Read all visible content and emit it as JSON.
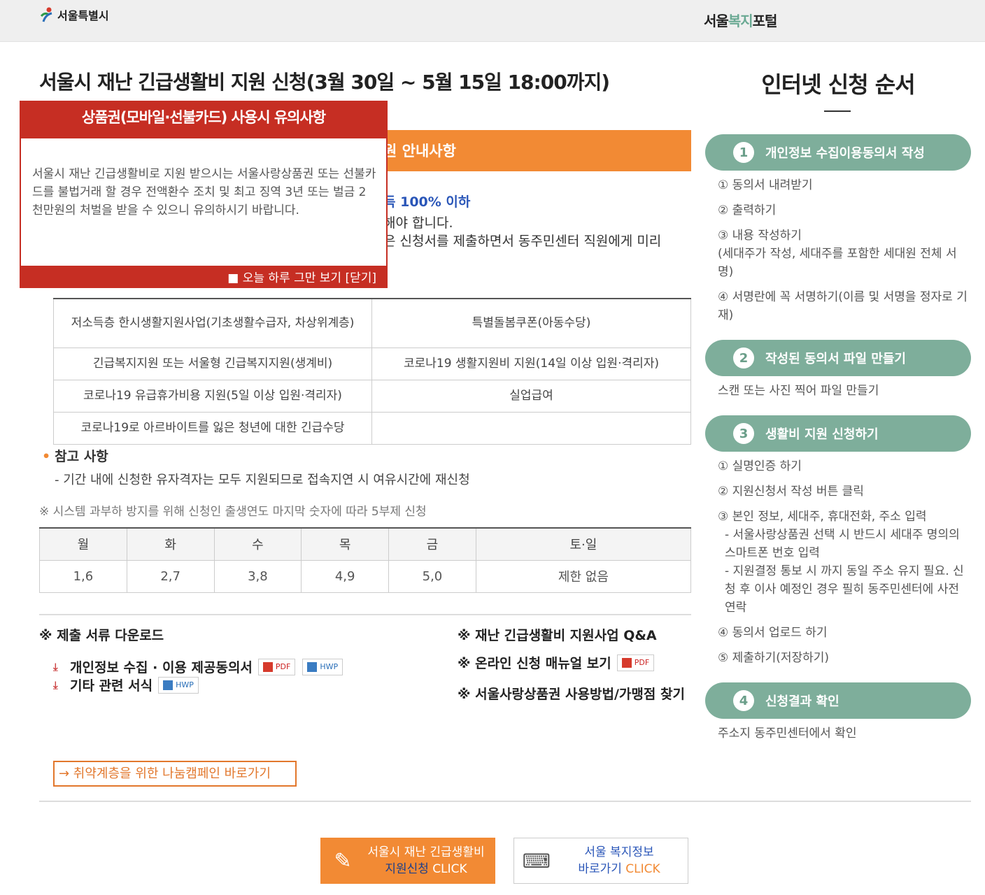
{
  "header": {
    "seoul_logo": "서울특별시",
    "portal_prefix": "서울",
    "portal_green": "복지",
    "portal_suffix": "포털"
  },
  "main": {
    "title": "서울시 재난 긴급생활비 지원 신청(3월 30일 ~ 5월 15일 18:00까지)",
    "banner": "원 안내사항",
    "criteria": "득 100% 이하",
    "line1": "해야 합니다.",
    "line2": "은 신청서를 제출하면서 동주민센터 직원에게 미리"
  },
  "popup": {
    "title": "상품권(모바일·선불카드) 사용시 유의사항",
    "body": "서울시 재난 긴급생활비로 지원 받으시는 서울사랑상품권 또는 선불카드를 불법거래 할 경우 전액환수 조치 및 최고 징역 3년 또는 벌금 2천만원의 처벌을 받을 수 있으니 유의하시기 바랍니다.",
    "footer": "■ 오늘 하루 그만 보기  [닫기]"
  },
  "program_table": {
    "rows": [
      [
        "저소득층 한시생활지원사업(기초생활수급자, 차상위계층)",
        "특별돌봄쿠폰(아동수당)"
      ],
      [
        "긴급복지지원 또는 서울형 긴급복지지원(생계비)",
        "코로나19 생활지원비 지원(14일 이상 입원·격리자)"
      ],
      [
        "코로나19 유급휴가비용 지원(5일 이상 입원·격리자)",
        "실업급여"
      ],
      [
        "코로나19로 아르바이트를 잃은 청년에 대한 긴급수당",
        ""
      ]
    ]
  },
  "reference": {
    "title": "참고 사항",
    "line": "- 기간 내에 신청한 유자격자는 모두 지원되므로 접속지연 시 여유시간에 재신청",
    "notice": "※ 시스템 과부하 방지를 위해 신청인 출생연도 마지막 숫자에 따라 5부제 신청"
  },
  "day_table": {
    "headers": [
      "월",
      "화",
      "수",
      "목",
      "금",
      "토·일"
    ],
    "values": [
      "1,6",
      "2,7",
      "3,8",
      "4,9",
      "5,0",
      "제한 없음"
    ]
  },
  "downloads": {
    "title": "※ 제출 서류 다운로드",
    "item1": "개인정보 수집 · 이용 제공동의서",
    "item2": "기타 관련 서식",
    "pdf": "PDF",
    "hwp": "HWP"
  },
  "links": {
    "qa": "※ 재난 긴급생활비 지원사업 Q&A",
    "manual": "※ 온라인 신청 매뉴얼 보기",
    "voucher": "※ 서울사랑상품권 사용방법/가맹점 찾기"
  },
  "campaign": "→ 취약계층을 위한 나눔캠페인 바로가기",
  "buttons": {
    "apply_line1": "서울시 재난 긴급생활비",
    "apply_line2a": "지원신청",
    "apply_line2b": " CLICK",
    "info_line1": "서울 복지정보",
    "info_line2a": "바로가기",
    "info_line2b": " CLICK"
  },
  "sidebar": {
    "title": "인터넷 신청 순서",
    "step1": {
      "num": "1",
      "label": "개인정보 수집이용동의서 작성"
    },
    "step1_items": [
      "① 동의서 내려받기",
      "② 출력하기",
      "③ 내용 작성하기\n(세대주가 작성, 세대주를 포함한 세대원 전체 서명)",
      "④ 서명란에 꼭 서명하기(이름 및 서명을 정자로 기재)"
    ],
    "step2": {
      "num": "2",
      "label": "작성된 동의서 파일 만들기"
    },
    "step2_items": [
      "스캔 또는 사진 찍어 파일 만들기"
    ],
    "step3": {
      "num": "3",
      "label": "생활비 지원 신청하기"
    },
    "step3_items": [
      "① 실명인증 하기",
      "② 지원신청서 작성 버튼 클릭",
      "③ 본인 정보, 세대주, 휴대전화, 주소 입력",
      "- 서울사랑상품권 선택 시 반드시 세대주 명의의 스마트폰 번호 입력",
      "- 지원결정 통보 시 까지 동일 주소 유지 필요. 신청 후 이사 예정인 경우 필히 동주민센터에 사전 연락",
      "④ 동의서 업로드 하기",
      "⑤ 제출하기(저장하기)"
    ],
    "step4": {
      "num": "4",
      "label": "신청결과 확인"
    },
    "step4_items": [
      "주소지 동주민센터에서 확인"
    ]
  }
}
